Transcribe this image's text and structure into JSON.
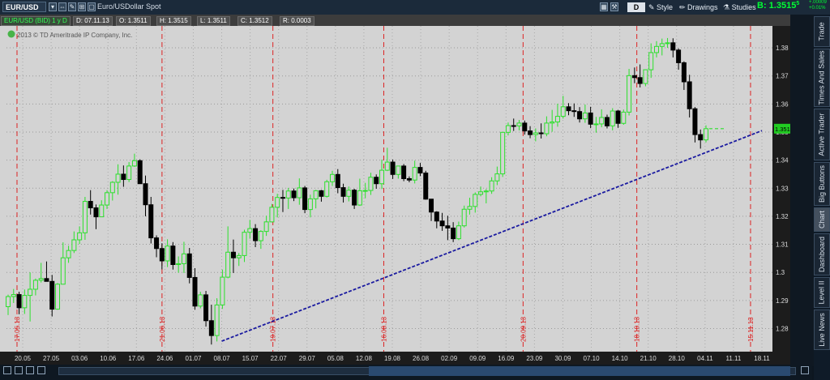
{
  "toolbar": {
    "symbol": "EUR/USD",
    "description": "Euro/USDollar Spot",
    "d_button": "D",
    "style": "Style",
    "drawings": "Drawings",
    "studies": "Studies",
    "bid": "B: 1.3515",
    "bid_sup": "5",
    "change_top": "+.00009",
    "change_bottom": "+0.01%"
  },
  "info": {
    "title": "EUR/USD (BID) 1 y D",
    "date": "D: 07.11.13",
    "open": "O: 1.3511",
    "high": "H: 1.3515",
    "low": "L: 1.3511",
    "close": "C: 1.3512",
    "range": "R: 0.0003",
    "copyright": "2013 © TD Ameritrade IP Company, Inc."
  },
  "side_tabs": [
    "Trade",
    "Times And Sales",
    "Active Trader",
    "Big Buttons",
    "Chart",
    "Dashboard",
    "Level II",
    "Live News"
  ],
  "chart_data": {
    "type": "candlestick",
    "ylim": [
      1.2735,
      1.3855
    ],
    "y_ticks": [
      1.28,
      1.29,
      1.3,
      1.31,
      1.32,
      1.33,
      1.34,
      1.35,
      1.36,
      1.37,
      1.38
    ],
    "y_tick_labels": [
      "1.28",
      "1.29",
      "1.3",
      "1.31",
      "1.32",
      "1.33",
      "1.34",
      "1.35",
      "1.36",
      "1.37",
      "1.38"
    ],
    "last_price": 1.3512,
    "last_price_label": "1.3512",
    "x_labels": [
      "20.05",
      "27.05",
      "03.06",
      "10.06",
      "17.06",
      "24.06",
      "01.07",
      "08.07",
      "15.07",
      "22.07",
      "29.07",
      "05.08",
      "12.08",
      "19.08",
      "26.08",
      "02.09",
      "09.09",
      "16.09",
      "23.09",
      "30.09",
      "07.10",
      "14.10",
      "21.10",
      "28.10",
      "04.11",
      "11.11",
      "18.11"
    ],
    "month_markers": [
      "17.05.13",
      "21.06.13",
      "19.07.13",
      "16.08.13",
      "20.09.13",
      "18.10.13",
      "15.11.13"
    ],
    "trendline": {
      "from": {
        "date": "08.07",
        "value": 1.2755
      },
      "to": {
        "date": "18.11",
        "value": 1.3505
      }
    },
    "candles": [
      [
        1.2878,
        1.2921,
        1.2848,
        1.2914
      ],
      [
        1.2914,
        1.2941,
        1.2891,
        1.2921
      ],
      [
        1.2921,
        1.2931,
        1.2851,
        1.2874
      ],
      [
        1.2874,
        1.2939,
        1.2852,
        1.2918
      ],
      [
        1.2918,
        1.3,
        1.2825,
        1.294
      ],
      [
        1.294,
        1.2978,
        1.2918,
        1.2972
      ],
      [
        1.2972,
        1.3034,
        1.2964,
        1.2978
      ],
      [
        1.2978,
        1.3039,
        1.2971,
        1.2968
      ],
      [
        1.2968,
        1.2991,
        1.2843,
        1.2869
      ],
      [
        1.2869,
        1.2962,
        1.2867,
        1.2958
      ],
      [
        1.2958,
        1.3107,
        1.2957,
        1.3052
      ],
      [
        1.3052,
        1.3095,
        1.3034,
        1.3078
      ],
      [
        1.3078,
        1.3146,
        1.3069,
        1.3116
      ],
      [
        1.3116,
        1.3164,
        1.3101,
        1.3141
      ],
      [
        1.3141,
        1.3269,
        1.3116,
        1.3253
      ],
      [
        1.3253,
        1.3293,
        1.3206,
        1.323
      ],
      [
        1.323,
        1.3242,
        1.3154,
        1.3198
      ],
      [
        1.3198,
        1.3257,
        1.3197,
        1.324
      ],
      [
        1.324,
        1.3293,
        1.3226,
        1.3284
      ],
      [
        1.3284,
        1.3325,
        1.3256,
        1.3321
      ],
      [
        1.3321,
        1.3385,
        1.3277,
        1.335
      ],
      [
        1.335,
        1.3381,
        1.3305,
        1.3331
      ],
      [
        1.3331,
        1.3393,
        1.3322,
        1.3379
      ],
      [
        1.3379,
        1.3423,
        1.3376,
        1.3398
      ],
      [
        1.3398,
        1.3403,
        1.3317,
        1.3316
      ],
      [
        1.3316,
        1.3345,
        1.32,
        1.3241
      ],
      [
        1.3241,
        1.3269,
        1.3103,
        1.3123
      ],
      [
        1.3123,
        1.3132,
        1.3054,
        1.3085
      ],
      [
        1.3085,
        1.3104,
        1.3011,
        1.3041
      ],
      [
        1.3041,
        1.3118,
        1.3019,
        1.3094
      ],
      [
        1.3094,
        1.3108,
        1.301,
        1.3028
      ],
      [
        1.3028,
        1.3057,
        1.2999,
        1.3031
      ],
      [
        1.3031,
        1.3109,
        1.2998,
        1.3066
      ],
      [
        1.3066,
        1.3087,
        1.2961,
        1.2982
      ],
      [
        1.2982,
        1.3015,
        1.2867,
        1.288
      ],
      [
        1.288,
        1.2931,
        1.2872,
        1.292
      ],
      [
        1.292,
        1.2934,
        1.2807,
        1.2828
      ],
      [
        1.2828,
        1.2885,
        1.2743,
        1.2775
      ],
      [
        1.2775,
        1.2908,
        1.2754,
        1.2884
      ],
      [
        1.2884,
        1.301,
        1.287,
        1.2983
      ],
      [
        1.2983,
        1.3164,
        1.2979,
        1.3072
      ],
      [
        1.3072,
        1.3117,
        1.2998,
        1.3052
      ],
      [
        1.3052,
        1.3069,
        1.3023,
        1.306
      ],
      [
        1.306,
        1.3152,
        1.3037,
        1.3143
      ],
      [
        1.3143,
        1.3187,
        1.312,
        1.3156
      ],
      [
        1.3156,
        1.3172,
        1.309,
        1.3113
      ],
      [
        1.3113,
        1.315,
        1.3084,
        1.3146
      ],
      [
        1.3146,
        1.3202,
        1.313,
        1.318
      ],
      [
        1.318,
        1.3244,
        1.3178,
        1.3232
      ],
      [
        1.3232,
        1.328,
        1.3196,
        1.3267
      ],
      [
        1.3267,
        1.3294,
        1.3215,
        1.3265
      ],
      [
        1.3265,
        1.3301,
        1.3226,
        1.329
      ],
      [
        1.329,
        1.3299,
        1.3254,
        1.3266
      ],
      [
        1.3266,
        1.3335,
        1.3241,
        1.3301
      ],
      [
        1.3301,
        1.3308,
        1.3211,
        1.3224
      ],
      [
        1.3224,
        1.3277,
        1.3196,
        1.3262
      ],
      [
        1.3262,
        1.3294,
        1.3228,
        1.3291
      ],
      [
        1.3291,
        1.3294,
        1.3252,
        1.3271
      ],
      [
        1.3271,
        1.333,
        1.3267,
        1.3323
      ],
      [
        1.3323,
        1.3362,
        1.3308,
        1.3349
      ],
      [
        1.3349,
        1.3368,
        1.3282,
        1.3302
      ],
      [
        1.3302,
        1.3316,
        1.3249,
        1.3271
      ],
      [
        1.3271,
        1.3306,
        1.3253,
        1.3293
      ],
      [
        1.3293,
        1.3298,
        1.3226,
        1.324
      ],
      [
        1.324,
        1.3334,
        1.3237,
        1.3291
      ],
      [
        1.3291,
        1.3319,
        1.3264,
        1.3292
      ],
      [
        1.3292,
        1.3355,
        1.3276,
        1.3339
      ],
      [
        1.3339,
        1.3349,
        1.3298,
        1.3316
      ],
      [
        1.3316,
        1.3402,
        1.3297,
        1.3364
      ],
      [
        1.3364,
        1.3444,
        1.3361,
        1.3393
      ],
      [
        1.3393,
        1.3402,
        1.3333,
        1.3349
      ],
      [
        1.3349,
        1.3379,
        1.3334,
        1.3379
      ],
      [
        1.3379,
        1.3386,
        1.3325,
        1.3334
      ],
      [
        1.3334,
        1.3342,
        1.3321,
        1.3329
      ],
      [
        1.3329,
        1.3398,
        1.3317,
        1.3374
      ],
      [
        1.3374,
        1.339,
        1.3343,
        1.3354
      ],
      [
        1.3354,
        1.3362,
        1.3259,
        1.3261
      ],
      [
        1.3261,
        1.3262,
        1.3183,
        1.3215
      ],
      [
        1.3215,
        1.3218,
        1.3157,
        1.3183
      ],
      [
        1.3183,
        1.3212,
        1.3148,
        1.3166
      ],
      [
        1.3166,
        1.3202,
        1.3115,
        1.3158
      ],
      [
        1.3158,
        1.3179,
        1.3108,
        1.312
      ],
      [
        1.312,
        1.3181,
        1.3115,
        1.3166
      ],
      [
        1.3166,
        1.3238,
        1.316,
        1.3225
      ],
      [
        1.3225,
        1.3266,
        1.3206,
        1.3235
      ],
      [
        1.3235,
        1.3285,
        1.3213,
        1.3278
      ],
      [
        1.3278,
        1.3306,
        1.3271,
        1.3287
      ],
      [
        1.3287,
        1.3297,
        1.3246,
        1.329
      ],
      [
        1.329,
        1.3339,
        1.328,
        1.3326
      ],
      [
        1.3326,
        1.3377,
        1.3311,
        1.3351
      ],
      [
        1.3351,
        1.3501,
        1.334,
        1.3499
      ],
      [
        1.3499,
        1.3534,
        1.3488,
        1.3523
      ],
      [
        1.3523,
        1.3548,
        1.3504,
        1.3522
      ],
      [
        1.3522,
        1.3543,
        1.3506,
        1.3532
      ],
      [
        1.3532,
        1.3541,
        1.3491,
        1.3504
      ],
      [
        1.3504,
        1.3521,
        1.3478,
        1.3491
      ],
      [
        1.3491,
        1.3513,
        1.3467,
        1.3497
      ],
      [
        1.3497,
        1.3531,
        1.3477,
        1.3494
      ],
      [
        1.3494,
        1.3556,
        1.3485,
        1.3532
      ],
      [
        1.3532,
        1.3579,
        1.3501,
        1.3536
      ],
      [
        1.3536,
        1.3601,
        1.3519,
        1.3556
      ],
      [
        1.3556,
        1.3629,
        1.3548,
        1.359
      ],
      [
        1.359,
        1.3603,
        1.356,
        1.3576
      ],
      [
        1.3576,
        1.3602,
        1.3554,
        1.3573
      ],
      [
        1.3573,
        1.3589,
        1.3534,
        1.3547
      ],
      [
        1.3547,
        1.3598,
        1.3533,
        1.3568
      ],
      [
        1.3568,
        1.359,
        1.3514,
        1.3528
      ],
      [
        1.3528,
        1.3554,
        1.3498,
        1.3529
      ],
      [
        1.3529,
        1.3581,
        1.3517,
        1.3552
      ],
      [
        1.3552,
        1.3562,
        1.3513,
        1.3522
      ],
      [
        1.3522,
        1.3585,
        1.3506,
        1.3575
      ],
      [
        1.3575,
        1.3579,
        1.3515,
        1.3531
      ],
      [
        1.3531,
        1.358,
        1.3526,
        1.3571
      ],
      [
        1.3571,
        1.3725,
        1.3559,
        1.3701
      ],
      [
        1.3701,
        1.373,
        1.3674,
        1.3694
      ],
      [
        1.3694,
        1.3741,
        1.3659,
        1.3673
      ],
      [
        1.3673,
        1.3723,
        1.3663,
        1.3722
      ],
      [
        1.3722,
        1.3816,
        1.3693,
        1.3783
      ],
      [
        1.3783,
        1.3824,
        1.3766,
        1.3805
      ],
      [
        1.3805,
        1.3833,
        1.3773,
        1.3815
      ],
      [
        1.3815,
        1.3835,
        1.38,
        1.3818
      ],
      [
        1.3818,
        1.3834,
        1.3766,
        1.3792
      ],
      [
        1.3792,
        1.3798,
        1.3722,
        1.3747
      ],
      [
        1.3747,
        1.3752,
        1.365,
        1.3679
      ],
      [
        1.3679,
        1.3704,
        1.3552,
        1.3583
      ],
      [
        1.3583,
        1.3589,
        1.3463,
        1.3491
      ],
      [
        1.3491,
        1.3509,
        1.3441,
        1.3472
      ],
      [
        1.3472,
        1.3524,
        1.3463,
        1.3512
      ]
    ]
  }
}
